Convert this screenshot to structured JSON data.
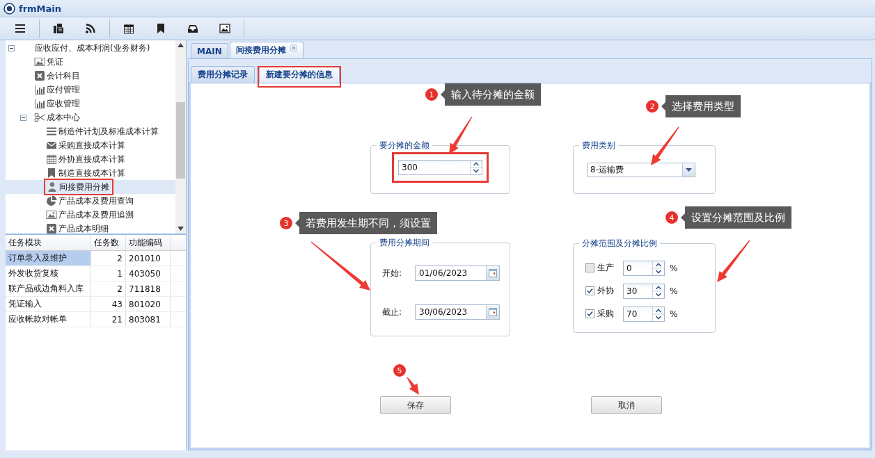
{
  "window": {
    "title": "frmMain"
  },
  "tree": {
    "items": [
      {
        "label": "应收应付、成本利润(业务财务)",
        "kind": "group",
        "expanded": true,
        "selected": false,
        "highlighted": false,
        "children": [
          {
            "label": "凭证",
            "kind": "image",
            "selected": false,
            "highlighted": false
          },
          {
            "label": "会计科目",
            "kind": "cross",
            "selected": false,
            "highlighted": false
          },
          {
            "label": "应付管理",
            "kind": "chart",
            "selected": false,
            "highlighted": false
          },
          {
            "label": "应收管理",
            "kind": "chart",
            "selected": false,
            "highlighted": false
          },
          {
            "label": "成本中心",
            "kind": "scissors",
            "expanded": true,
            "selected": false,
            "highlighted": false,
            "children": [
              {
                "label": "制造件计划及标准成本计算",
                "kind": "lines",
                "selected": false,
                "highlighted": false
              },
              {
                "label": "采购直接成本计算",
                "kind": "envelope",
                "selected": false,
                "highlighted": false
              },
              {
                "label": "外协直接成本计算",
                "kind": "calendar",
                "selected": false,
                "highlighted": false
              },
              {
                "label": "制造直接成本计算",
                "kind": "bookmark",
                "selected": false,
                "highlighted": false
              },
              {
                "label": "间接费用分摊",
                "kind": "person",
                "selected": true,
                "highlighted": true
              },
              {
                "label": "产品成本及费用查询",
                "kind": "pie",
                "selected": false,
                "highlighted": false
              },
              {
                "label": "产品成本及费用追溯",
                "kind": "image",
                "selected": false,
                "highlighted": false
              },
              {
                "label": "产品成本明细",
                "kind": "cross",
                "selected": false,
                "highlighted": false
              }
            ]
          }
        ]
      }
    ]
  },
  "task_table": {
    "columns": [
      "任务模块",
      "任务数",
      "功能编码"
    ],
    "rows": [
      {
        "cells": [
          "订单录入及维护",
          "2",
          "201010"
        ],
        "selected": true
      },
      {
        "cells": [
          "外发收货复核",
          "1",
          "403050"
        ],
        "selected": false
      },
      {
        "cells": [
          "联产品或边角料入库",
          "2",
          "711818"
        ],
        "selected": false
      },
      {
        "cells": [
          "凭证输入",
          "43",
          "801020"
        ],
        "selected": false
      },
      {
        "cells": [
          "应收帐款对帐单",
          "21",
          "803081"
        ],
        "selected": false
      }
    ]
  },
  "tabs": [
    {
      "label": "MAIN",
      "selected": false,
      "closable": false
    },
    {
      "label": "间接费用分摊",
      "selected": true,
      "closable": true
    }
  ],
  "sub_tabs": [
    {
      "label": "费用分摊记录",
      "selected": false,
      "highlighted": false
    },
    {
      "label": "新建要分摊的信息",
      "selected": true,
      "highlighted": true
    }
  ],
  "form": {
    "amount": {
      "legend": "要分摊的金额",
      "value": "300",
      "highlighted": true
    },
    "category": {
      "legend": "费用类别",
      "value": "8-运输费"
    },
    "period": {
      "legend": "费用分摊期间",
      "rows": [
        {
          "label": "开始:",
          "value": "01/06/2023"
        },
        {
          "label": "截止:",
          "value": "30/06/2023"
        }
      ]
    },
    "range": {
      "legend": "分摊范围及分摊比例",
      "rows": [
        {
          "label": "生产",
          "checked": false,
          "value": "0",
          "unit": "%"
        },
        {
          "label": "外协",
          "checked": true,
          "value": "30",
          "unit": "%"
        },
        {
          "label": "采购",
          "checked": true,
          "value": "70",
          "unit": "%"
        }
      ]
    },
    "buttons": [
      "保存",
      "取消"
    ]
  },
  "callouts": [
    {
      "number": "1",
      "text": "输入待分摊的金额"
    },
    {
      "number": "2",
      "text": "选择费用类型"
    },
    {
      "number": "3",
      "text": "若费用发生期不同，须设置"
    },
    {
      "number": "4",
      "text": "设置分摊范围及比例"
    },
    {
      "number": "5"
    }
  ]
}
